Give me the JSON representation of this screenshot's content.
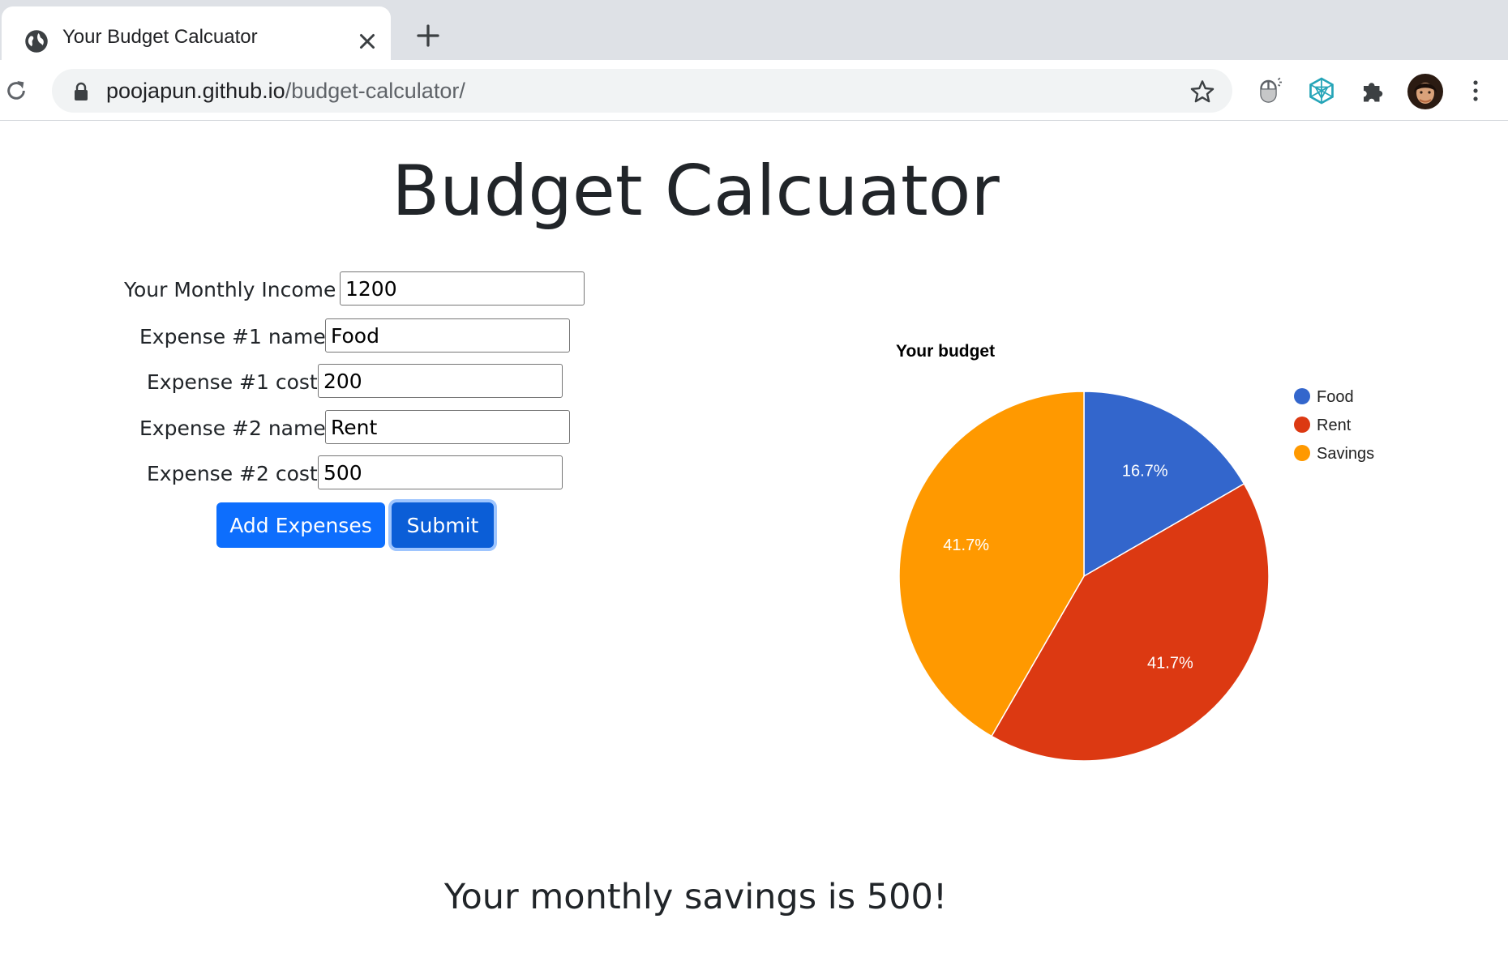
{
  "browser": {
    "tab_title": "Your Budget Calcuator",
    "url_host": "poojapun.github.io",
    "url_path": "/budget-calculator/"
  },
  "page": {
    "title": "Budget Calcuator",
    "form": {
      "income_label": "Your Monthly Income",
      "income_value": "1200",
      "expense1_name_label": "Expense #1 name",
      "expense1_name_value": "Food",
      "expense1_cost_label": "Expense #1 cost",
      "expense1_cost_value": "200",
      "expense2_name_label": "Expense #2 name",
      "expense2_name_value": "Rent",
      "expense2_cost_label": "Expense #2 cost",
      "expense2_cost_value": "500"
    },
    "buttons": {
      "add_expenses": "Add Expenses",
      "submit": "Submit"
    },
    "result": "Your monthly savings is 500!"
  },
  "chart_data": {
    "type": "pie",
    "title": "Your budget",
    "categories": [
      "Food",
      "Rent",
      "Savings"
    ],
    "values": [
      200,
      500,
      500
    ],
    "labels": [
      "16.7%",
      "41.7%",
      "41.7%"
    ],
    "colors": [
      "#3366cc",
      "#dc3912",
      "#ff9900"
    ],
    "legend": "right"
  },
  "icons": [
    "globe-icon",
    "close-icon",
    "plus-icon",
    "reload-icon",
    "lock-icon",
    "star-icon",
    "extension-icon",
    "puzzle-icon",
    "avatar",
    "kebab-menu-icon"
  ]
}
